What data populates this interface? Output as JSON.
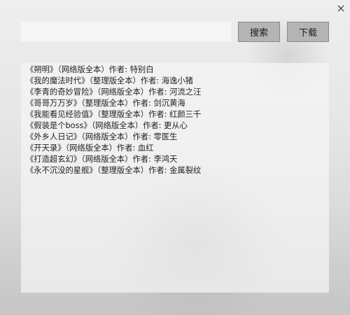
{
  "window": {
    "close_icon": "close-icon"
  },
  "search": {
    "value": "",
    "placeholder": ""
  },
  "buttons": {
    "search_label": "搜索",
    "download_label": "下载"
  },
  "results": [
    "《朔明》（网络版全本）作者: 特别白",
    "《我的魔法时代》（整理版全本）作者: 海逸小猪",
    "《李青的奇妙冒险》（网络版全本）作者: 河流之汪",
    "《哥哥万万岁》（整理版全本）作者: 剑沉黄海",
    "《我能看见经验值》（整理版全本）作者: 红颜三千",
    "《假装是个boss》（网络版全本）作者: 更从心",
    "《外乡人日记》（网络版全本）作者: 零医生",
    "《开天录》（网络版全本）作者: 血红",
    "《打造超玄幻》（网络版全本）作者: 李鸿天",
    "《永不沉没的星舰》（整理版全本）作者: 金属裂纹"
  ]
}
